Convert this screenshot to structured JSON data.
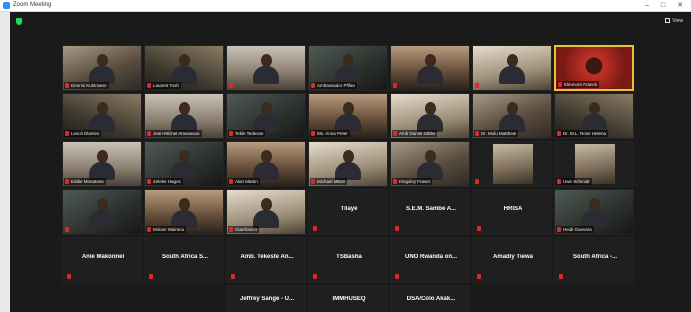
{
  "window": {
    "title": "Zoom Meeting",
    "controls": [
      "–",
      "□",
      "✕"
    ]
  },
  "view_button": "View",
  "tiles": [
    {
      "kind": "video",
      "label": "Dennis Kuhlmann"
    },
    {
      "kind": "video",
      "label": "Laurent Tosh"
    },
    {
      "kind": "video",
      "label": ""
    },
    {
      "kind": "video",
      "label": "Ambassador Pfifan"
    },
    {
      "kind": "video",
      "label": ""
    },
    {
      "kind": "video",
      "label": ""
    },
    {
      "kind": "video",
      "label": "Eléonore Franck"
    },
    {
      "kind": "video",
      "label": "Lesoli Dlamini"
    },
    {
      "kind": "video",
      "label": "Jean-Michel Amoussou"
    },
    {
      "kind": "video",
      "label": "Tekle Tedesse"
    },
    {
      "kind": "video",
      "label": "Ms. Anna Peter"
    },
    {
      "kind": "video",
      "label": "Amb Daniel Gibbs"
    },
    {
      "kind": "video",
      "label": "Dr. Mulu Matthew"
    },
    {
      "kind": "video",
      "label": "Dr. M.L. Rose Helena"
    },
    {
      "kind": "video",
      "label": "Eddie Monatone"
    },
    {
      "kind": "video",
      "label": "Zeleke Hagos"
    },
    {
      "kind": "video",
      "label": "Alan Martin"
    },
    {
      "kind": "video",
      "label": "Michael Mbuti"
    },
    {
      "kind": "video",
      "label": "Kingsley Fraser"
    },
    {
      "kind": "video",
      "label": ""
    },
    {
      "kind": "video",
      "label": "Uwe Schmidt"
    },
    {
      "kind": "video",
      "label": ""
    },
    {
      "kind": "video",
      "label": "Miriam Wairimu"
    },
    {
      "kind": "video",
      "label": "Gianfranco"
    },
    {
      "kind": "blank",
      "label": "Tilaye"
    },
    {
      "kind": "blank",
      "label": "S.E.M. Sambe A..."
    },
    {
      "kind": "blank",
      "label": "HRISA"
    },
    {
      "kind": "video",
      "label": "Heidi Guevara"
    },
    {
      "kind": "blank",
      "label": "Anie Makonnel"
    },
    {
      "kind": "blank",
      "label": "South Africa S..."
    },
    {
      "kind": "blank",
      "label": "Amb. Tekeste An..."
    },
    {
      "kind": "blank",
      "label": "TSBasha"
    },
    {
      "kind": "blank",
      "label": "UNO Rwanda on..."
    },
    {
      "kind": "blank",
      "label": "Amadiy Tiewa"
    },
    {
      "kind": "blank",
      "label": "South Africa -..."
    },
    {
      "kind": "blank",
      "label": "Jeffrey Sange - U..."
    },
    {
      "kind": "blank",
      "label": "IMMHUSEQ"
    },
    {
      "kind": "blank",
      "label": "DSA/Colo Akak..."
    }
  ],
  "colors": {
    "meeting_bg": "#1a1a1a",
    "tile_bg": "#1f1f1f",
    "muted_mic": "#e02828",
    "security_shield": "#23d959"
  }
}
